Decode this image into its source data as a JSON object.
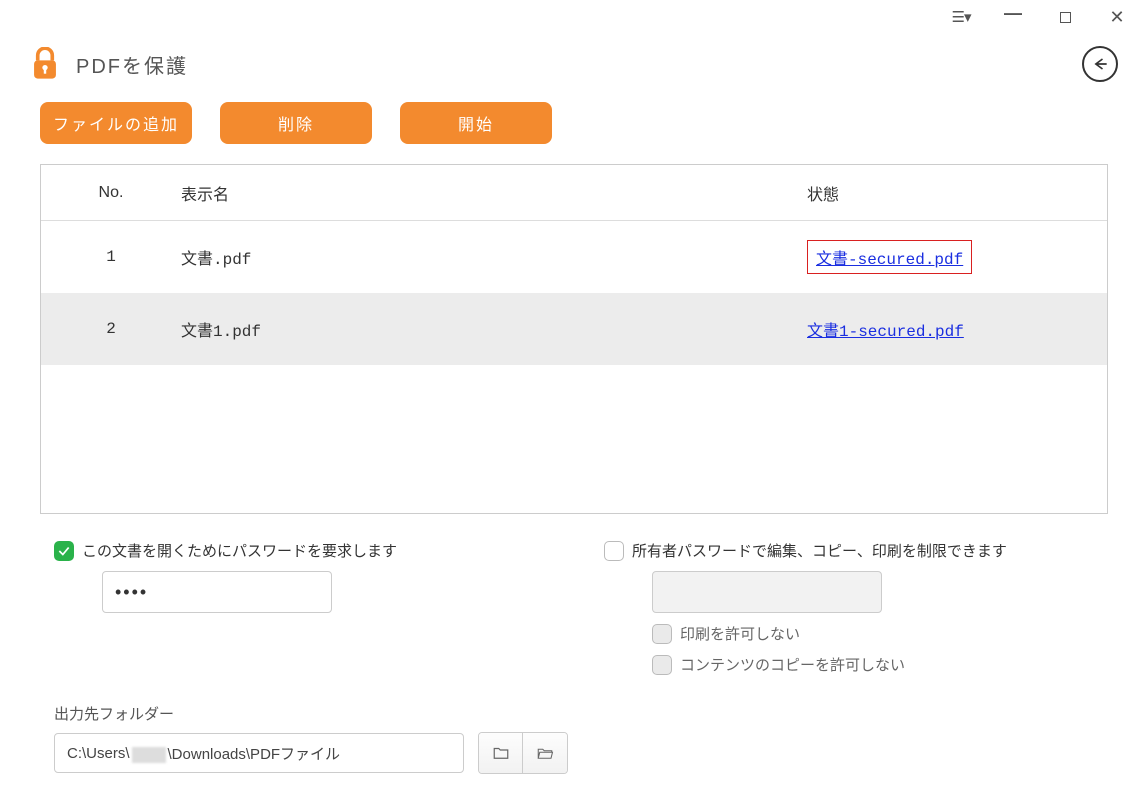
{
  "header": {
    "title": "PDFを保護"
  },
  "toolbar": {
    "add_label": "ファイルの追加",
    "delete_label": "削除",
    "start_label": "開始"
  },
  "table": {
    "columns": {
      "no": "No.",
      "name": "表示名",
      "status": "状態"
    },
    "rows": [
      {
        "no": "1",
        "name": "文書.pdf",
        "status_link": "文書-secured.pdf",
        "highlight": true
      },
      {
        "no": "2",
        "name": "文書1.pdf",
        "status_link": "文書1-secured.pdf",
        "highlight": false
      }
    ]
  },
  "options": {
    "open_password_label": "この文書を開くためにパスワードを要求します",
    "open_password_value": "••••",
    "owner_password_label": "所有者パスワードで編集、コピー、印刷を制限できます",
    "disallow_print_label": "印刷を許可しない",
    "disallow_copy_label": "コンテンツのコピーを許可しない"
  },
  "output": {
    "label": "出力先フォルダー",
    "path_prefix": "C:\\Users\\",
    "path_suffix": "\\Downloads\\PDFファイル"
  }
}
